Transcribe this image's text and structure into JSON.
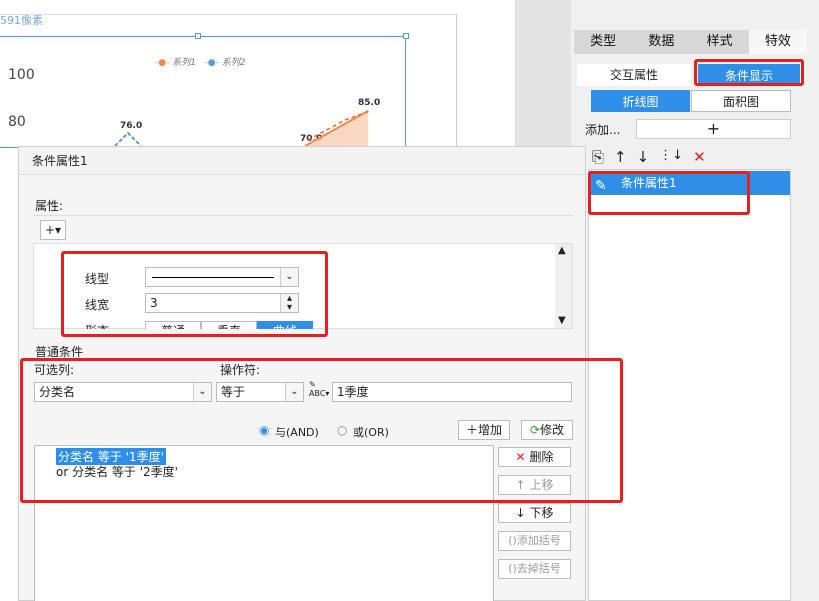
{
  "canvas": {
    "size_label": "591像素",
    "y_ticks": [
      "100",
      "80"
    ],
    "legend": {
      "series1": "系列1",
      "series2": "系列2"
    },
    "data_labels": [
      "76.0",
      "70.0",
      "85.0"
    ]
  },
  "right_panel": {
    "tabs": [
      "类型",
      "数据",
      "样式",
      "特效"
    ],
    "active_tab": "特效",
    "subtabs": {
      "interaction": "交互属性",
      "condition": "条件显示"
    },
    "chart_tabs": {
      "line": "折线图",
      "area": "面积图"
    },
    "add_label": "添加...",
    "add_button": "+",
    "list_items": [
      "条件属性1"
    ]
  },
  "dialog": {
    "title": "条件属性1",
    "attr_section": "属性:",
    "add_button": "+▾",
    "line_type_label": "线型",
    "line_width_label": "线宽",
    "line_width_value": "3",
    "shape_label": "形态",
    "shape_options": [
      "普通",
      "垂直",
      "曲线"
    ],
    "normal_condition": "普通条件",
    "column_label": "可选列:",
    "column_value": "分类名",
    "operator_label": "操作符:",
    "operator_value": "等于",
    "value_field": "1季度",
    "and_label": "与(AND)",
    "or_label": "或(OR)",
    "add_cond_button": "增加",
    "modify_button": "修改",
    "conditions": [
      "分类名 等于 '1季度'",
      "or  分类名 等于 '2季度'"
    ],
    "delete_button": "删除",
    "move_up_button": "上移",
    "move_down_button": "下移",
    "add_bracket_button": "添加括号",
    "remove_bracket_button": "去掉括号"
  }
}
